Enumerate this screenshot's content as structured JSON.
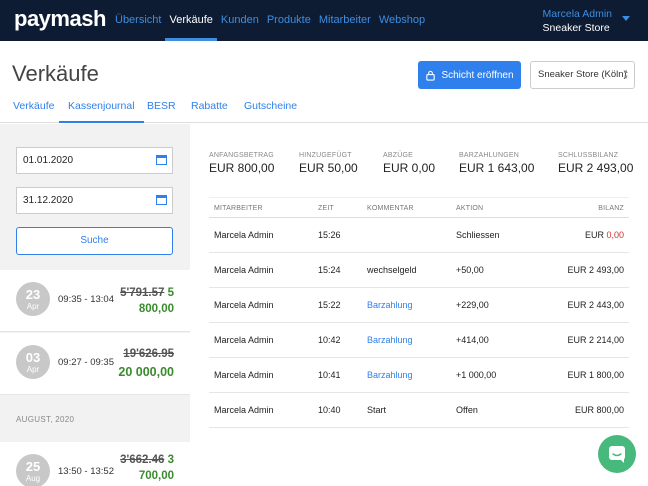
{
  "app": {
    "logo": "paymash"
  },
  "nav": {
    "items": [
      "Übersicht",
      "Verkäufe",
      "Kunden",
      "Produkte",
      "Mitarbeiter",
      "Webshop"
    ],
    "active": 1
  },
  "user": {
    "name": "Marcela Admin",
    "store": "Sneaker Store"
  },
  "page": {
    "title": "Verkäufe",
    "shift_button": "Schicht eröffnen",
    "store_select": "Sneaker Store (Köln)"
  },
  "tabs": [
    "Verkäufe",
    "Kassenjournal",
    "BESR",
    "Rabatte",
    "Gutscheine"
  ],
  "filter": {
    "date_from": "01.01.2020",
    "date_to": "31.12.2020",
    "search_label": "Suche"
  },
  "journal": [
    {
      "day": "23",
      "month": "Apr",
      "time": "09:35 - 13:04",
      "old": "5'791.57",
      "new_a": "5",
      "new_b": "800,00"
    },
    {
      "day": "03",
      "month": "Apr",
      "time": "09:27 - 09:35",
      "old": "19'626.95",
      "new_a": "",
      "new_b": "20 000,00"
    },
    {
      "day": "25",
      "month": "Aug",
      "time": "13:50 - 13:52",
      "old": "3'662.46",
      "new_a": "3",
      "new_b": "700,00"
    }
  ],
  "journal_month_label": "AUGUST, 2020",
  "summary": [
    {
      "label": "ANFANGSBETRAG",
      "value": "EUR 800,00"
    },
    {
      "label": "HINZUGEFÜGT",
      "value": "EUR 50,00"
    },
    {
      "label": "ABZÜGE",
      "value": "EUR 0,00"
    },
    {
      "label": "BARZAHLUNGEN",
      "value": "EUR 1 643,00"
    },
    {
      "label": "SCHLUSSBILANZ",
      "value": "EUR 2 493,00"
    }
  ],
  "table": {
    "headers": [
      "MITARBEITER",
      "ZEIT",
      "KOMMENTAR",
      "AKTION",
      "BILANZ"
    ],
    "rows": [
      {
        "employee": "Marcela Admin",
        "time": "15:26",
        "comment": "",
        "action": "Schliessen",
        "balance_a": "EUR ",
        "balance_b": "0,00"
      },
      {
        "employee": "Marcela Admin",
        "time": "15:24",
        "comment": "wechselgeld",
        "action": "+50,00",
        "balance_a": "EUR 2 493,00",
        "balance_b": ""
      },
      {
        "employee": "Marcela Admin",
        "time": "15:22",
        "comment": "Barzahlung",
        "action": "+229,00",
        "balance_a": "EUR 2 443,00",
        "balance_b": ""
      },
      {
        "employee": "Marcela Admin",
        "time": "10:42",
        "comment": "Barzahlung",
        "action": "+414,00",
        "balance_a": "EUR 2 214,00",
        "balance_b": ""
      },
      {
        "employee": "Marcela Admin",
        "time": "10:41",
        "comment": "Barzahlung",
        "action": "+1 000,00",
        "balance_a": "EUR 1 800,00",
        "balance_b": ""
      },
      {
        "employee": "Marcela Admin",
        "time": "10:40",
        "comment": "Start",
        "action": "Offen",
        "balance_a": "EUR 800,00",
        "balance_b": ""
      }
    ]
  },
  "colors": {
    "topbar": "#0d1b33",
    "accent": "#2f80ed",
    "positive": "#3a8a2e",
    "negative": "#d32f2f",
    "chat": "#47b97d"
  }
}
